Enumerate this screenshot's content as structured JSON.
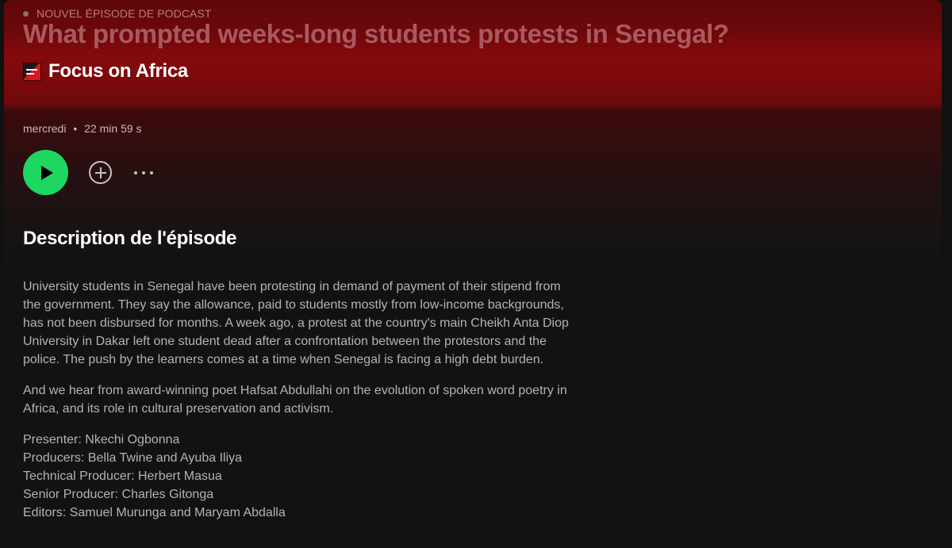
{
  "header": {
    "eyebrow": "NOUVEL ÉPISODE DE PODCAST",
    "title": "What prompted weeks-long students protests in Senegal?",
    "show_name": "Focus on Africa"
  },
  "meta": {
    "day": "mercredi",
    "separator": "•",
    "duration": "22 min 59 s"
  },
  "controls": {
    "play_icon": "play-icon",
    "add_icon": "plus-circle-icon",
    "more_icon": "more-horizontal-icon",
    "play_color": "#1ed760"
  },
  "description": {
    "heading": "Description de l'épisode",
    "paragraph_1": "University students in Senegal have been protesting in demand of payment of their stipend from the government. They say the allowance, paid to students mostly from low-income backgrounds, has not been disbursed for months. A week ago, a protest at the country's main Cheikh Anta Diop University in Dakar left one student dead after a confrontation between the protestors and the police. The push by the learners comes at a time when Senegal is facing a high debt burden.",
    "paragraph_2": "And we hear from award-winning poet Hafsat Abdullahi on the evolution of spoken word poetry in Africa, and its role in cultural preservation and activism.",
    "credits": [
      "Presenter: Nkechi Ogbonna",
      "Producers: Bella Twine and Ayuba Iliya",
      "Technical Producer: Herbert Masua",
      "Senior Producer: Charles Gitonga",
      "Editors: Samuel Murunga and Maryam Abdalla"
    ]
  },
  "colors": {
    "header_red": "#7d0a0c",
    "background": "#121212",
    "accent_green": "#1ed760"
  }
}
